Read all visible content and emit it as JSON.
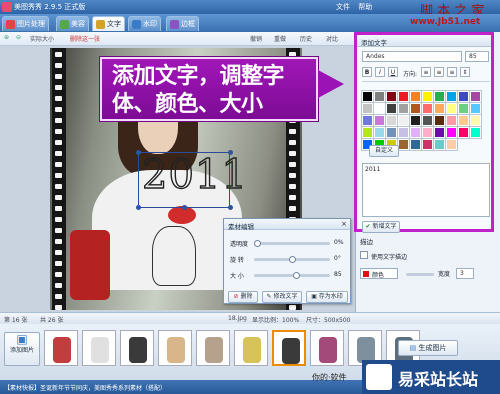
{
  "window": {
    "title": "美图秀秀 2.9.5 正式版",
    "menu": [
      "文件",
      "帮助"
    ]
  },
  "watermark_top": {
    "line1": "脚 本 之 家",
    "line2": "www.Jb51.net"
  },
  "tabs": [
    {
      "label": "图片处理",
      "color": "#e24343"
    },
    {
      "label": "美容",
      "color": "#52a84a"
    },
    {
      "label": "文字",
      "color": "#d2a229"
    },
    {
      "label": "水印",
      "color": "#3a7cc8"
    },
    {
      "label": "边框",
      "color": "#8b54c0"
    }
  ],
  "toolbar": {
    "left": [
      "实际大小",
      "删除这一张"
    ],
    "right": [
      "撤销",
      "重做",
      "历史",
      "对比"
    ]
  },
  "annotation": {
    "text": "添加文字，调整字体、颜色、大小",
    "color": "#9b13b4"
  },
  "canvas": {
    "text": "2011"
  },
  "text_panel": {
    "title": "添加文字",
    "font": "Andes",
    "size": "85",
    "format_buttons": [
      "B",
      "I",
      "U"
    ],
    "direction_label": "方向:",
    "custom_button": "自定义",
    "text_value": "2011",
    "new_text_button": "新增文字",
    "palette": [
      "#000000",
      "#7f7f7f",
      "#880015",
      "#ed1c24",
      "#ff7f27",
      "#fff200",
      "#22b14c",
      "#00a2e8",
      "#3f48cc",
      "#a349a4",
      "#c3c3c3",
      "#ffffff",
      "#404040",
      "#a0a0a0",
      "#b5541f",
      "#ff6a6a",
      "#ffaa55",
      "#ffff80",
      "#6cd07c",
      "#55c8ff",
      "#6f79e0",
      "#c878d8",
      "#d8d8d8",
      "#f0f0f0",
      "#1f1f1f",
      "#555555",
      "#5b2a09",
      "#ff9aa8",
      "#ffc990",
      "#fff9b0",
      "#b5e61d",
      "#99d9ea",
      "#7092be",
      "#c8bfe7",
      "#e0b0ff",
      "#ffaec9",
      "#6a0dad",
      "#ff00ff",
      "#ff0066",
      "#00ffcc",
      "#0066ff",
      "#00cc00",
      "#cccc00",
      "#996633",
      "#336699",
      "#cc3366",
      "#66cccc",
      "#ffccaa"
    ]
  },
  "stroke_panel": {
    "title": "描边",
    "checkbox_label": "使用文字描边",
    "color_label": "颜色",
    "width_label": "宽度",
    "width_value": "3",
    "color": "#dd1111"
  },
  "material_popup": {
    "title": "素材编辑",
    "rows": [
      {
        "label": "透明度",
        "value": "0%",
        "level": 0.0
      },
      {
        "label": "旋 转",
        "value": "0°",
        "level": 0.5
      },
      {
        "label": "大 小",
        "value": "85",
        "level": 0.55
      }
    ],
    "buttons": [
      "删除",
      "修改文字",
      "存为水印"
    ]
  },
  "statusbar": {
    "count": "第 16 张",
    "total": "共 26 张",
    "filename": "18.jpg",
    "ratio": "显示比例：100%",
    "size": "尺寸：500x500"
  },
  "thumbs": {
    "add_button": "添加图片",
    "generate_button": "生成图片",
    "colors": [
      "#c23d3d",
      "#e0e0e0",
      "#3a3a3a",
      "#d9b68a",
      "#b5a18c",
      "#d8c25a",
      "#3a3a3a",
      "#a44a7a",
      "#7e8f9e",
      "#5d6f7d"
    ]
  },
  "bottombar": {
    "tip": "【素材快报】圣诞新年节节同庆，美图秀秀系列素材（搭配）"
  },
  "watermark_bottom": {
    "text": "易采站长站",
    "prefix": "你的·软件"
  }
}
